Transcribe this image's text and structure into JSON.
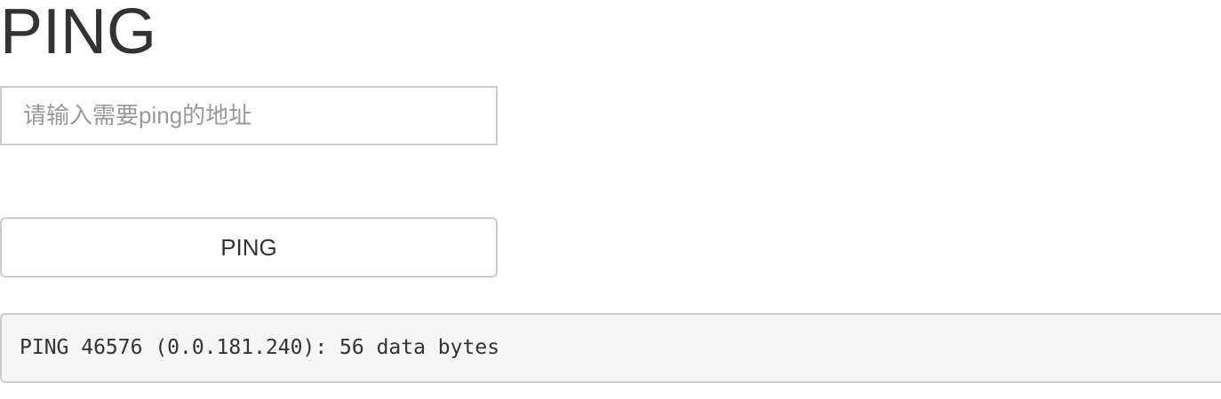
{
  "page": {
    "title": "PING"
  },
  "form": {
    "host_value": "",
    "host_placeholder": "请输入需要ping的地址",
    "submit_label": "PING"
  },
  "result": {
    "output_text": "PING 46576 (0.0.181.240): 56 data bytes"
  },
  "colors": {
    "text": "#333333",
    "placeholder": "#999999",
    "border": "#cccccc",
    "output_background": "#f5f5f5",
    "page_background": "#ffffff"
  }
}
